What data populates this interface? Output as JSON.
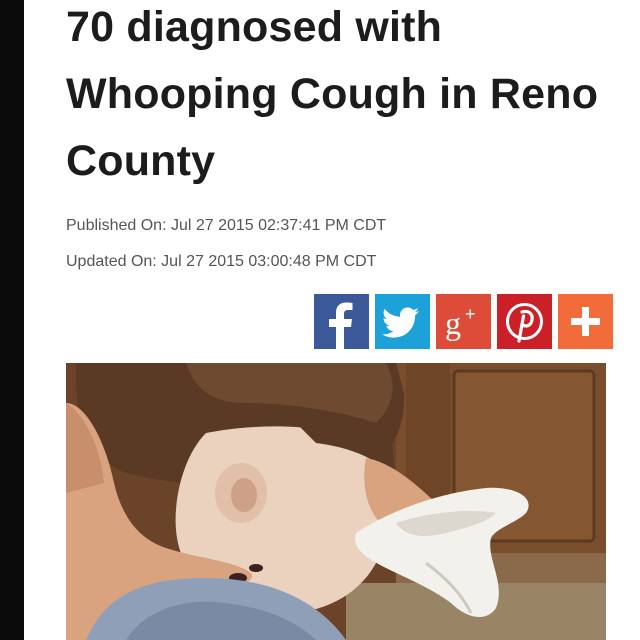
{
  "article": {
    "headline": "70 diagnosed with Whooping Cough in Reno County",
    "published": "Published On: Jul 27 2015 02:37:41 PM CDT",
    "updated": "Updated On: Jul 27 2015 03:00:48 PM CDT"
  },
  "share": {
    "buttons": [
      {
        "name": "facebook",
        "icon": "facebook-icon",
        "color": "#3b5998"
      },
      {
        "name": "twitter",
        "icon": "twitter-icon",
        "color": "#1da1d9"
      },
      {
        "name": "google-plus",
        "icon": "google-plus-icon",
        "color": "#dd4b39"
      },
      {
        "name": "pinterest",
        "icon": "pinterest-icon",
        "color": "#cb2027"
      },
      {
        "name": "more",
        "icon": "plus-icon",
        "color": "#f26b3a"
      }
    ]
  },
  "photo": {
    "subject": "baby-with-tissue-image"
  }
}
